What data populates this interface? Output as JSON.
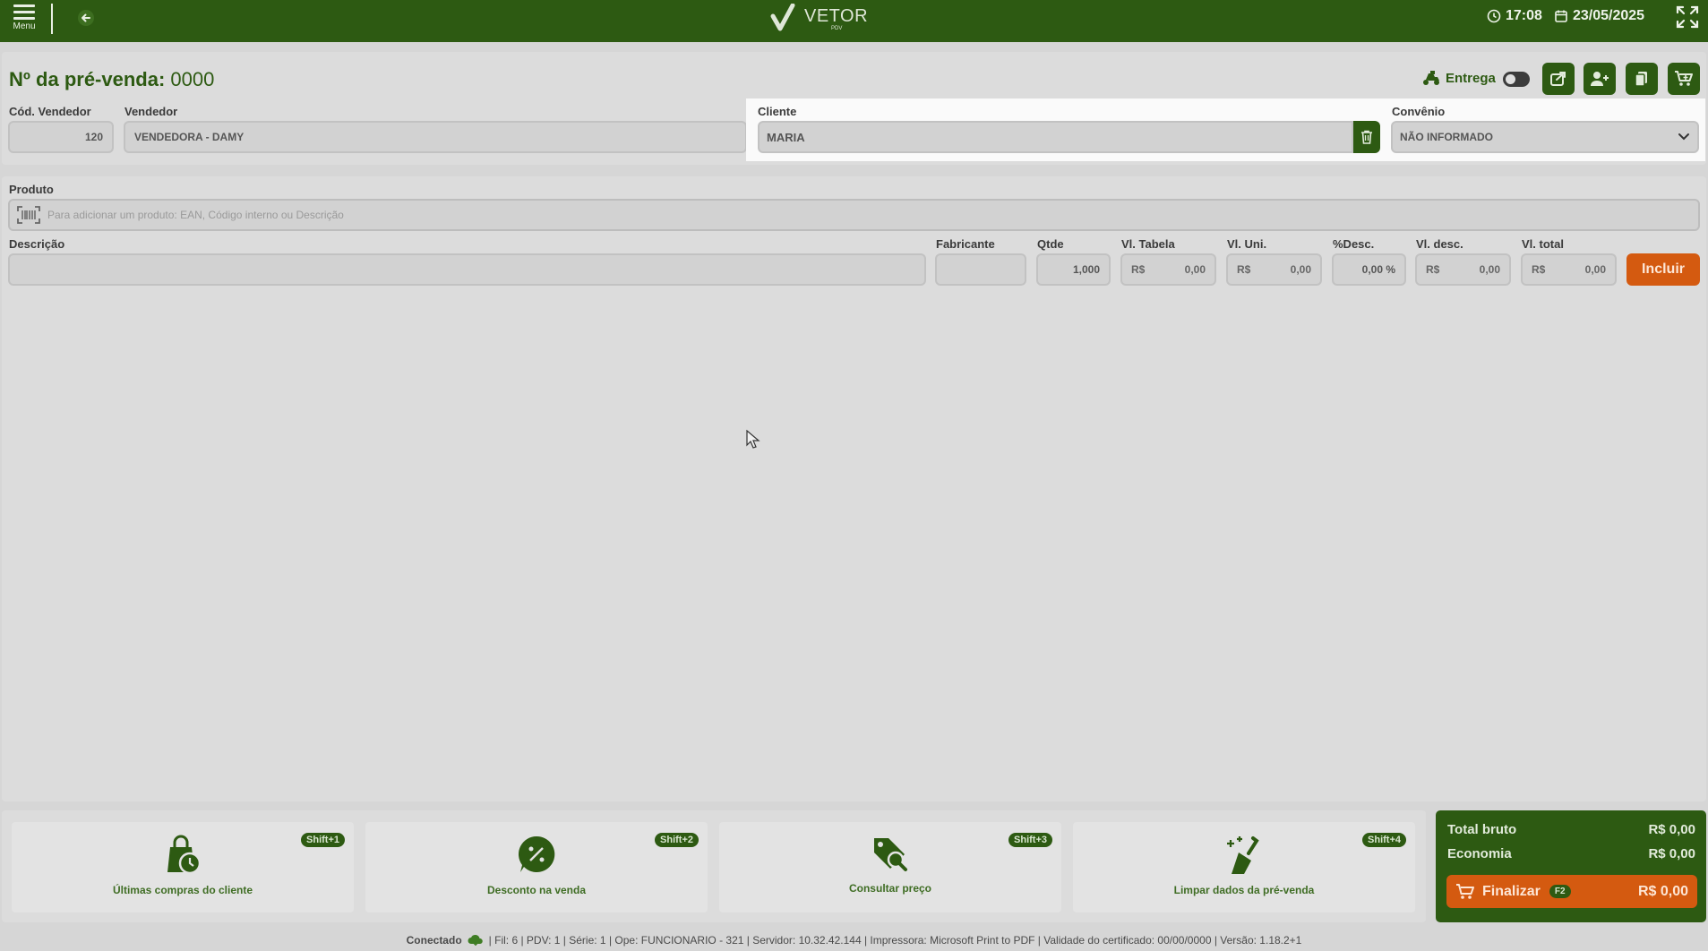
{
  "topbar": {
    "menu_label": "Menu",
    "logo_main": "VETOR",
    "logo_sub": "PDV",
    "time": "17:08",
    "date": "23/05/2025"
  },
  "header": {
    "title_label": "Nº da pré-venda:",
    "title_number": "0000",
    "entrega_label": "Entrega",
    "cod_vendedor_label": "Cód. Vendedor",
    "cod_vendedor_value": "120",
    "vendedor_label": "Vendedor",
    "vendedor_value": "VENDEDORA - DAMY",
    "cliente_label": "Cliente",
    "cliente_value": "MARIA",
    "convenio_label": "Convênio",
    "convenio_value": "NÃO INFORMADO"
  },
  "product": {
    "label": "Produto",
    "placeholder": "Para adicionar um produto: EAN, Código interno ou Descrição",
    "descricao_label": "Descrição",
    "fabricante_label": "Fabricante",
    "qtde_label": "Qtde",
    "qtde_value": "1,000",
    "vl_tabela_label": "Vl. Tabela",
    "vl_uni_label": "Vl. Uni.",
    "desc_pct_label": "%Desc.",
    "desc_pct_value": "0,00 %",
    "vl_desc_label": "Vl. desc.",
    "vl_total_label": "Vl. total",
    "currency": "R$",
    "zero": "0,00",
    "incluir_label": "Incluir"
  },
  "actions": [
    {
      "label": "Últimas compras do cliente",
      "shortcut": "Shift+1"
    },
    {
      "label": "Desconto na venda",
      "shortcut": "Shift+2"
    },
    {
      "label": "Consultar preço",
      "shortcut": "Shift+3"
    },
    {
      "label": "Limpar dados da pré-venda",
      "shortcut": "Shift+4"
    }
  ],
  "totals": {
    "bruto_label": "Total bruto",
    "bruto_value": "R$ 0,00",
    "economia_label": "Economia",
    "economia_value": "R$ 0,00",
    "finalizar_label": "Finalizar",
    "finalizar_key": "F2",
    "finalizar_value": "R$ 0,00"
  },
  "status": {
    "conectado": "Conectado",
    "details": "| Fil: 6 | PDV: 1 | Série: 1 | Ope: FUNCIONARIO - 321 | Servidor: 10.32.42.144 | Impressora: Microsoft Print to PDF | Validade do certificado: 00/00/0000 | Versão: 1.18.2+1"
  },
  "colors": {
    "primary_green": "#2d5a12",
    "accent_orange": "#d45a10",
    "background": "#d6d6d6"
  }
}
